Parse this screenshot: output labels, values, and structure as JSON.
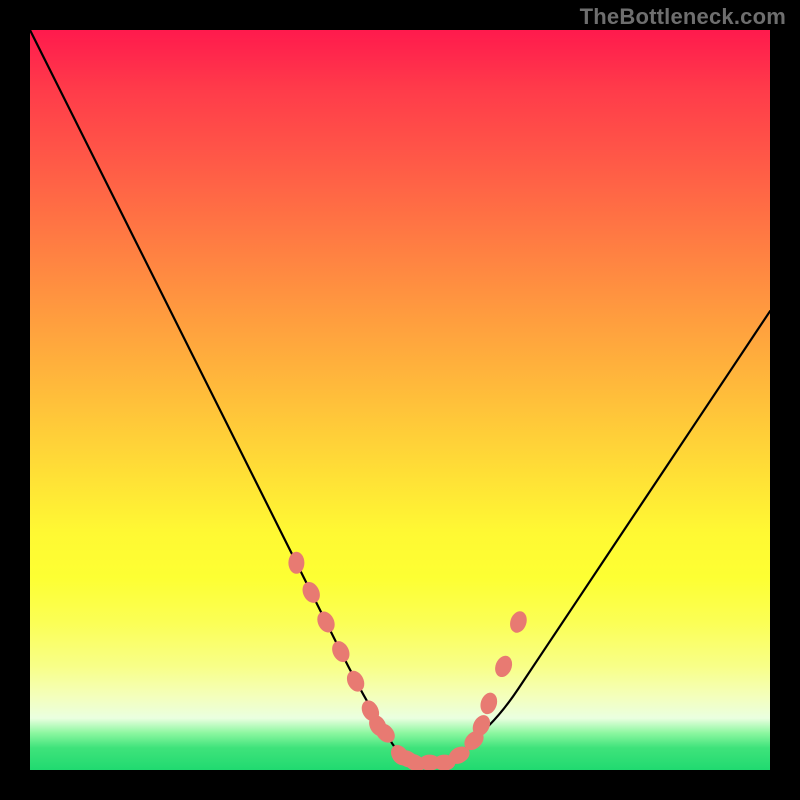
{
  "watermark": "TheBottleneck.com",
  "colors": {
    "frame": "#000000",
    "curve": "#000000",
    "markers": "#e87a72",
    "gradient_top": "#ff1a4d",
    "gradient_bottom": "#20da70"
  },
  "chart_data": {
    "type": "line",
    "title": "",
    "xlabel": "",
    "ylabel": "",
    "xlim": [
      0,
      100
    ],
    "ylim": [
      0,
      100
    ],
    "x": [
      0,
      4,
      8,
      12,
      16,
      20,
      24,
      28,
      32,
      36,
      40,
      44,
      48,
      50,
      52,
      54,
      56,
      58,
      60,
      64,
      68,
      72,
      76,
      80,
      84,
      88,
      92,
      96,
      100
    ],
    "series": [
      {
        "name": "bottleneck-curve",
        "values": [
          100,
          92,
          84,
          76,
          68,
          60,
          52,
          44,
          36,
          28,
          20,
          12,
          5,
          2,
          1,
          1,
          1,
          2,
          4,
          8,
          14,
          20,
          26,
          32,
          38,
          44,
          50,
          56,
          62
        ]
      }
    ],
    "markers": {
      "name": "highlighted-points",
      "x": [
        36,
        38,
        40,
        42,
        44,
        46,
        47,
        48,
        50,
        51,
        52,
        54,
        56,
        58,
        60,
        61,
        62,
        64,
        66
      ],
      "y": [
        28,
        24,
        20,
        16,
        12,
        8,
        6,
        5,
        2,
        1.5,
        1,
        1,
        1,
        2,
        4,
        6,
        9,
        14,
        20
      ]
    }
  }
}
